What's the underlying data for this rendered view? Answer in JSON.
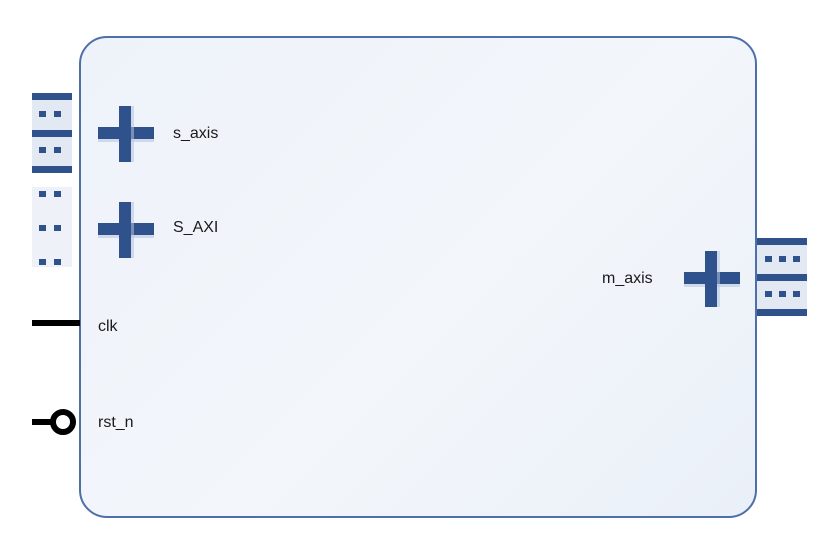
{
  "block": {
    "ports_left": {
      "s_axis": "s_axis",
      "s_axi": "S_AXI",
      "clk": "clk",
      "rst_n": "rst_n"
    },
    "ports_right": {
      "m_axis": "m_axis"
    }
  },
  "colors": {
    "block_border": "#4f6fa8",
    "block_fill": "#eef3fa",
    "interface_blue": "#2f528c",
    "wire": "#000000"
  }
}
